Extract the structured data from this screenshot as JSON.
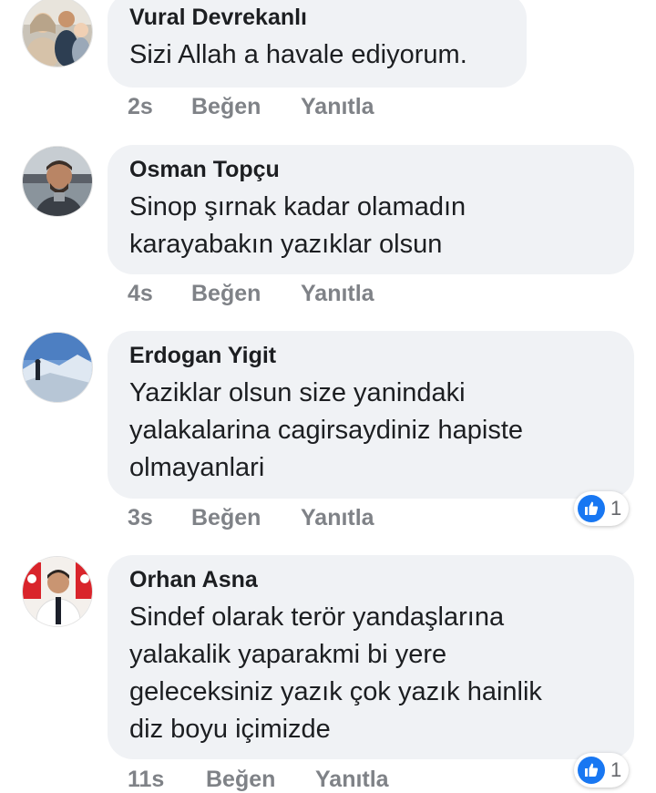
{
  "comments": [
    {
      "author": "Vural Devrekanlı",
      "text": "Sizi Allah a havale ediyorum.",
      "time": "2s",
      "like_label": "Beğen",
      "reply_label": "Yanıtla",
      "avatar_icon": "profile-photo"
    },
    {
      "author": "Osman Topçu",
      "text": "Sinop şırnak kadar olamadın\nkarayabakın yazıklar olsun",
      "time": "4s",
      "like_label": "Beğen",
      "reply_label": "Yanıtla",
      "avatar_icon": "profile-photo"
    },
    {
      "author": "Erdogan Yigit",
      "text": "Yaziklar olsun size yanindaki\nyalakalarina cagirsaydiniz  hapiste\nolmayanlari",
      "time": "3s",
      "like_label": "Beğen",
      "reply_label": "Yanıtla",
      "reaction_count": "1",
      "avatar_icon": "profile-photo"
    },
    {
      "author": "Orhan Asna",
      "text": "Sindef olarak terör yandaşlarına\nyalakalik yaparakmi bi yere\ngeleceksiniz yazık çok yazık hainlik\ndiz boyu içimizde",
      "time": "11s",
      "like_label": "Beğen",
      "reply_label": "Yanıtla",
      "reaction_count": "1",
      "avatar_icon": "profile-photo"
    }
  ],
  "colors": {
    "bubble": "#f0f2f5",
    "text": "#1c1e21",
    "meta": "#7f8287",
    "like_blue": "#1877f2"
  }
}
